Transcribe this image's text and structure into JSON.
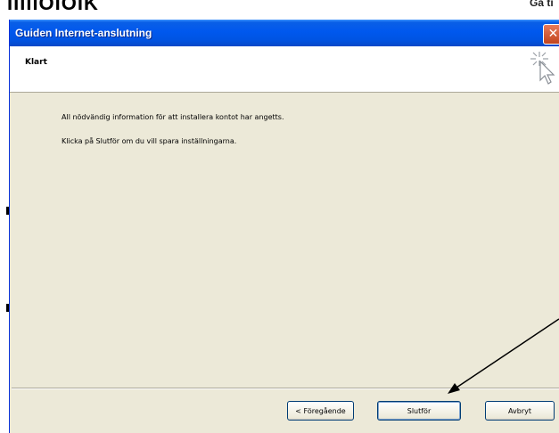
{
  "background": {
    "app_fragment_left": "IIIIIOIOIK",
    "app_fragment_right": "Gå ti"
  },
  "window": {
    "title": "Guiden Internet-anslutning",
    "close_glyph": "✕"
  },
  "header": {
    "title": "Klart",
    "icon": "wizard-cursor-icon"
  },
  "body": {
    "line1": "All nödvändig information för att installera kontot har angetts.",
    "line2": "Klicka på Slutför om du vill spara inställningarna."
  },
  "buttons": {
    "previous": "< Föregående",
    "finish": "Slutför",
    "cancel": "Avbryt"
  },
  "colors": {
    "titlebar": "#0054e3",
    "window_bg": "#ece9d8",
    "close_button": "#c1441d"
  }
}
